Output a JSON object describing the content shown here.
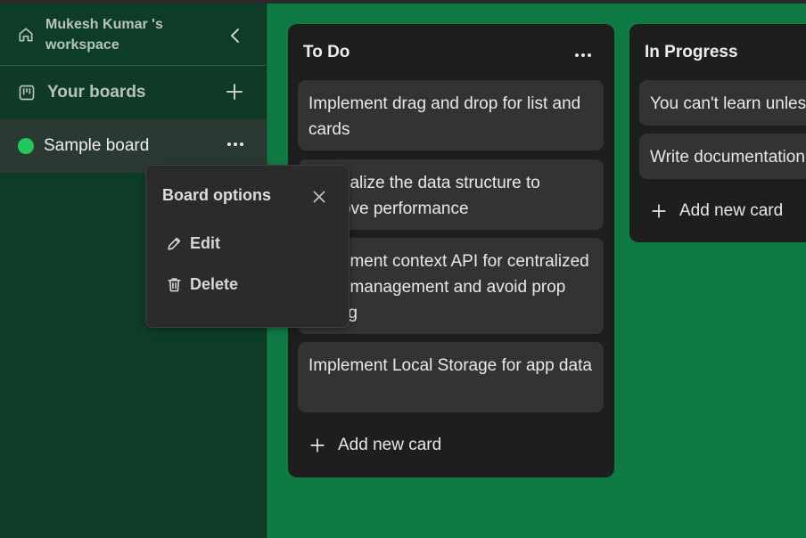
{
  "workspace": {
    "title": "Mukesh Kumar 's workspace"
  },
  "sidebar": {
    "boards_label": "Your boards",
    "boards": [
      {
        "label": "Sample board",
        "color": "#22c55e"
      }
    ]
  },
  "lists": [
    {
      "title": "To Do",
      "cards": [
        "Implement drag and drop for list and cards",
        "Normalize the data structure to improve performance",
        "Implement context API for centralized state management and avoid prop drilling",
        "Implement Local Storage for app data"
      ],
      "add_label": "Add new card"
    },
    {
      "title": "In Progress",
      "cards": [
        "You can't learn unless you try",
        "Write documentation"
      ],
      "add_label": "Add new card"
    }
  ],
  "popover": {
    "title": "Board options",
    "items": [
      {
        "label": "Edit"
      },
      {
        "label": "Delete"
      }
    ]
  },
  "colors": {
    "sidebar_bg": "#0d3d27",
    "main_bg": "#0f7a44",
    "list_bg": "#1e1e1e",
    "card_bg": "#333333",
    "board_dot": "#22c55e"
  }
}
